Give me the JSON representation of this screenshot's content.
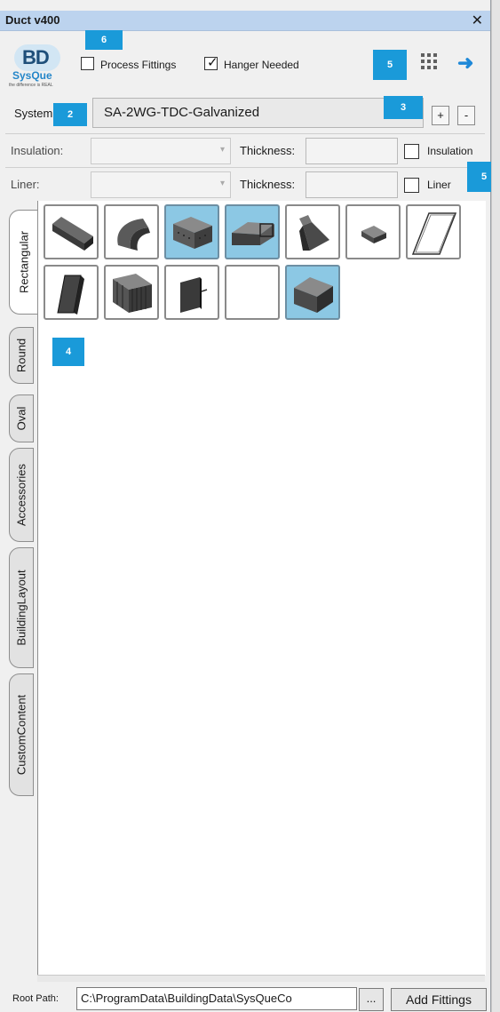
{
  "window": {
    "title": "Duct v400",
    "close_glyph": "✕"
  },
  "logo": {
    "mark": "BD",
    "brand": "SysQue",
    "tagline": "the difference is REAL"
  },
  "options": {
    "process_fittings": {
      "label": "Process Fittings",
      "checked": false
    },
    "hanger_needed": {
      "label": "Hanger Needed",
      "checked": true
    }
  },
  "toolbar_icons": [
    "grid-icon",
    "arrow-right-icon"
  ],
  "system": {
    "label": "System",
    "value": "SA-2WG-TDC-Galvanized",
    "add_label": "+",
    "remove_label": "-"
  },
  "insulation": {
    "label": "Insulation:",
    "value": "",
    "thickness_label": "Thickness:",
    "thickness_value": "",
    "checkbox_label": "Insulation",
    "checked": false
  },
  "liner": {
    "label": "Liner:",
    "value": "",
    "thickness_label": "Thickness:",
    "thickness_value": "",
    "checkbox_label": "Liner",
    "checked": false
  },
  "badges": {
    "b6": "6",
    "b5a": "5",
    "b2": "2",
    "b3": "3",
    "b5b": "5",
    "b4": "4"
  },
  "tabs": [
    {
      "label": "Rectangular",
      "active": true
    },
    {
      "label": "Round",
      "active": false
    },
    {
      "label": "Oval",
      "active": false
    },
    {
      "label": "Accessories",
      "active": false
    },
    {
      "label": "BuildingLayout",
      "active": false
    },
    {
      "label": "CustomContent",
      "active": false
    }
  ],
  "fittings": [
    {
      "icon": "straight-duct-icon",
      "selected": false
    },
    {
      "icon": "elbow-icon",
      "selected": false
    },
    {
      "icon": "box-fitting-icon",
      "selected": true
    },
    {
      "icon": "offset-transition-icon",
      "selected": true
    },
    {
      "icon": "transition-icon",
      "selected": false
    },
    {
      "icon": "small-box-icon",
      "selected": false
    },
    {
      "icon": "flat-panel-icon",
      "selected": false
    },
    {
      "icon": "dark-panel-icon",
      "selected": false
    },
    {
      "icon": "ribbed-duct-icon",
      "selected": false
    },
    {
      "icon": "damper-plate-icon",
      "selected": false
    },
    {
      "icon": "empty-icon",
      "selected": false
    },
    {
      "icon": "cube-icon",
      "selected": true
    }
  ],
  "root_path": {
    "label": "Root Path:",
    "value": "C:\\ProgramData\\BuildingData\\SysQueCo",
    "browse_label": "...",
    "add_fittings_label": "Add Fittings"
  }
}
